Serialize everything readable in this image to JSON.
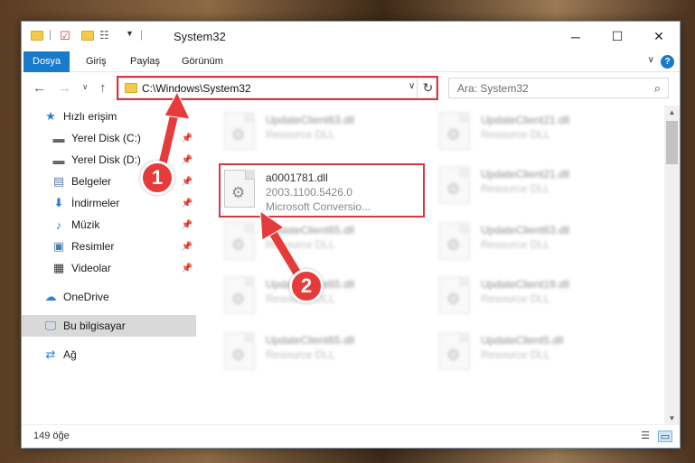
{
  "window": {
    "title": "System32",
    "controls": {
      "minimize": "─",
      "maximize": "☐",
      "close": "✕"
    }
  },
  "ribbon": {
    "tabs": [
      {
        "label": "Dosya",
        "active": true
      },
      {
        "label": "Giriş"
      },
      {
        "label": "Paylaş"
      },
      {
        "label": "Görünüm"
      }
    ],
    "help": "?"
  },
  "navbar": {
    "address": "C:\\Windows\\System32",
    "search_placeholder": "Ara: System32"
  },
  "sidebar": {
    "items": [
      {
        "label": "Hızlı erişim",
        "icon": "star-icon",
        "pinned": false
      },
      {
        "label": "Yerel Disk (C:)",
        "icon": "drive-icon",
        "pinned": true
      },
      {
        "label": "Yerel Disk (D:)",
        "icon": "drive-icon",
        "pinned": true
      },
      {
        "label": "Belgeler",
        "icon": "document-icon",
        "pinned": true
      },
      {
        "label": "İndirmeler",
        "icon": "download-icon",
        "pinned": true
      },
      {
        "label": "Müzik",
        "icon": "music-icon",
        "pinned": true
      },
      {
        "label": "Resimler",
        "icon": "picture-icon",
        "pinned": true
      },
      {
        "label": "Videolar",
        "icon": "video-icon",
        "pinned": true
      },
      {
        "label": "OneDrive",
        "icon": "cloud-icon",
        "pinned": false
      },
      {
        "label": "Bu bilgisayar",
        "icon": "computer-icon",
        "pinned": false,
        "selected": true
      },
      {
        "label": "Ağ",
        "icon": "network-icon",
        "pinned": false
      }
    ]
  },
  "files": {
    "highlighted": {
      "name": "a0001781.dll",
      "version": "2003.1100.5426.0",
      "company": "Microsoft Conversio..."
    },
    "blurred": [
      {
        "name": "UpdateClient63.dll",
        "desc": "Resource DLL"
      },
      {
        "name": "UpdateClient21.dll",
        "desc": "Resource DLL"
      },
      {
        "name": "UpdateClient21.dll",
        "desc": "Resource DLL"
      },
      {
        "name": "UpdateClient65.dll",
        "desc": "Resource DLL"
      },
      {
        "name": "UpdateClient63.dll",
        "desc": "Resource DLL"
      },
      {
        "name": "UpdateClient65.dll",
        "desc": "Resource DLL"
      },
      {
        "name": "UpdateClient19.dll",
        "desc": "Resource DLL"
      },
      {
        "name": "UpdateClient65.dll",
        "desc": "Resource DLL"
      },
      {
        "name": "UpdateClient5.dll",
        "desc": "Resource DLL"
      }
    ]
  },
  "status": {
    "count": "149 öğe"
  },
  "callouts": {
    "one": "1",
    "two": "2"
  },
  "colors": {
    "accent": "#1979ca",
    "highlight": "#d9363e",
    "badge": "#e63b3b"
  }
}
